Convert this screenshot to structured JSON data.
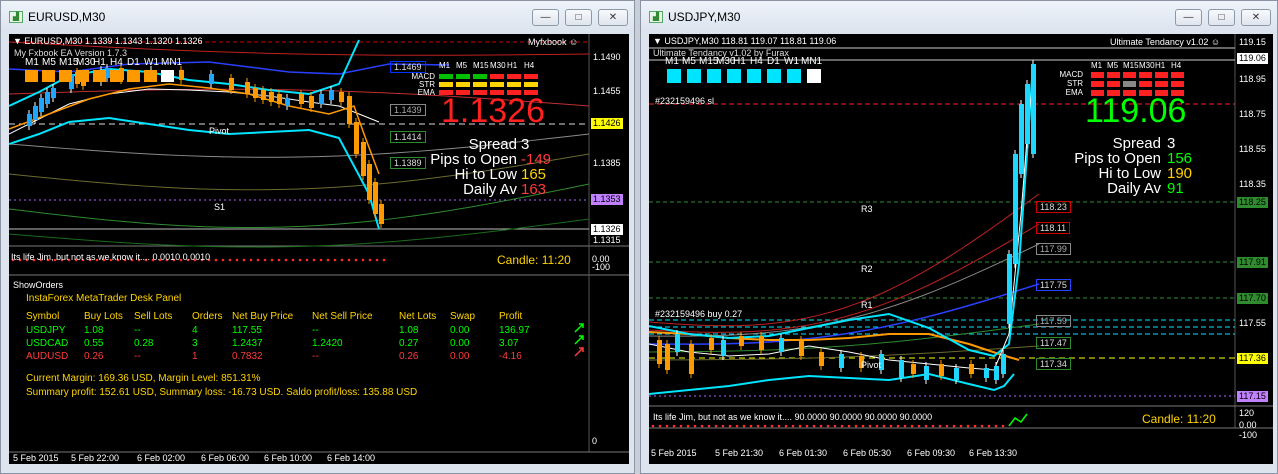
{
  "left": {
    "title": "EURUSD,M30",
    "chart_header": "EURUSD,M30  1.1339 1.1343 1.1320 1.1326",
    "indicator_name": "Myfxbook",
    "ea_overlay": "My Fxbook EA Version 1.7.3",
    "timeframes": [
      "M1",
      "M5",
      "M15",
      "M30",
      "H1",
      "H4",
      "D1",
      "W1",
      "MN1"
    ],
    "table_timeframes": [
      "M1",
      "M5",
      "M15",
      "M30",
      "H1",
      "H4"
    ],
    "row_labels": [
      "MACD",
      "STR",
      "EMA"
    ],
    "price_big": "1.1326",
    "stats": [
      {
        "label": "Spread",
        "value": "3",
        "color": "#ffffff"
      },
      {
        "label": "Pips to Open",
        "value": "-149",
        "color": "#ff3b3b"
      },
      {
        "label": "Hi to Low",
        "value": "165",
        "color": "#ffd400"
      },
      {
        "label": "Daily Av",
        "value": "163",
        "color": "#ff3b3b"
      }
    ],
    "level_tags": [
      "1.1469",
      "1.1439",
      "1.1414",
      "1.1389"
    ],
    "level_names": [
      "Pivot",
      "S1"
    ],
    "price_axis": [
      "1.1490",
      "1.1455",
      "1.1426",
      "1.1385",
      "1.1353",
      "1.1326",
      "1.1315"
    ],
    "sub_window": "Its life Jim, but not as we know it....  0.0010 0.0010",
    "sub_axis": [
      "0.00",
      "-100"
    ],
    "candle_timer": "Candle:  11:20",
    "show_orders": "ShowOrders",
    "panel_title": "InstaForex MetaTrader Desk Panel",
    "orders_header": [
      "Symbol",
      "Buy Lots",
      "Sell Lots",
      "Orders",
      "Net Buy Price",
      "Net Sell Price",
      "Net Lots",
      "Swap",
      "Profit"
    ],
    "orders": [
      {
        "cells": [
          "USDJPY",
          "1.08",
          "--",
          "4",
          "117.55",
          "--",
          "1.08",
          "0.00",
          "136.97"
        ],
        "color": "#00ff00"
      },
      {
        "cells": [
          "USDCAD",
          "0.55",
          "0.28",
          "3",
          "1.2437",
          "1.2420",
          "0.27",
          "0.00",
          "3.07"
        ],
        "color": "#00ff00"
      },
      {
        "cells": [
          "AUDUSD",
          "0.26",
          "--",
          "1",
          "0.7832",
          "--",
          "0.26",
          "0.00",
          "-4.16"
        ],
        "color": "#ff3b3b"
      }
    ],
    "margin_line": "Current Margin: 169.36 USD, Margin Level: 851.31%",
    "summary_line": "Summary profit: 152.61 USD, Summary loss: -16.73 USD.  Saldo profit/loss: 135.88 USD",
    "panel_axis": [
      "0"
    ],
    "time_axis": [
      "5 Feb 2015",
      "5 Feb 22:00",
      "6 Feb 02:00",
      "6 Feb 06:00",
      "6 Feb 10:00",
      "6 Feb 14:00"
    ]
  },
  "right": {
    "title": "USDJPY,M30",
    "chart_header": "USDJPY,M30  118.81 119.07 118.81 119.06",
    "indicator_name": "Ultimate Tendancy v1.02",
    "ea_overlay": "Ultimate Tendancy v1.02 by Furax",
    "timeframes": [
      "M1",
      "M5",
      "M15",
      "M30",
      "H1",
      "H4",
      "D1",
      "W1",
      "MN1"
    ],
    "table_timeframes": [
      "M1",
      "M5",
      "M15",
      "M30",
      "H1",
      "H4"
    ],
    "row_labels": [
      "MACD",
      "STR",
      "EMA"
    ],
    "order_label_sl": "#232159496 sl",
    "order_label_buy": "#232159496 buy 0.27",
    "price_big": "119.06",
    "stats": [
      {
        "label": "Spread",
        "value": "3",
        "color": "#ffffff"
      },
      {
        "label": "Pips to Open",
        "value": "156",
        "color": "#00ff00"
      },
      {
        "label": "Hi to Low",
        "value": "190",
        "color": "#ffd400"
      },
      {
        "label": "Daily Av",
        "value": "91",
        "color": "#00ff00"
      }
    ],
    "level_tags": [
      "118.23",
      "118.11",
      "117.99",
      "117.75",
      "117.59",
      "117.47",
      "117.34"
    ],
    "level_names": [
      "R3",
      "R2",
      "R1",
      "Pivot"
    ],
    "price_axis": [
      "119.15",
      "119.06",
      "118.95",
      "118.75",
      "118.55",
      "118.35",
      "118.25",
      "117.91",
      "117.70",
      "117.55",
      "117.36",
      "117.15"
    ],
    "sub_window": "Its life Jim, but not as we know it....  90.0000 90.0000 90.0000 90.0000",
    "sub_axis": [
      "120",
      "0.00",
      "-100"
    ],
    "candle_timer": "Candle:  11:20",
    "time_axis": [
      "5 Feb 2015",
      "5 Feb 21:30",
      "6 Feb 01:30",
      "6 Feb 05:30",
      "6 Feb 09:30",
      "6 Feb 13:30"
    ]
  },
  "colors": {
    "bg": "#000000",
    "bull": "#ffffff",
    "bear": "#ff9900",
    "cyan": "#00e5ff",
    "red": "#ff2a2a",
    "green": "#00ff00",
    "yellow": "#ffff00"
  }
}
